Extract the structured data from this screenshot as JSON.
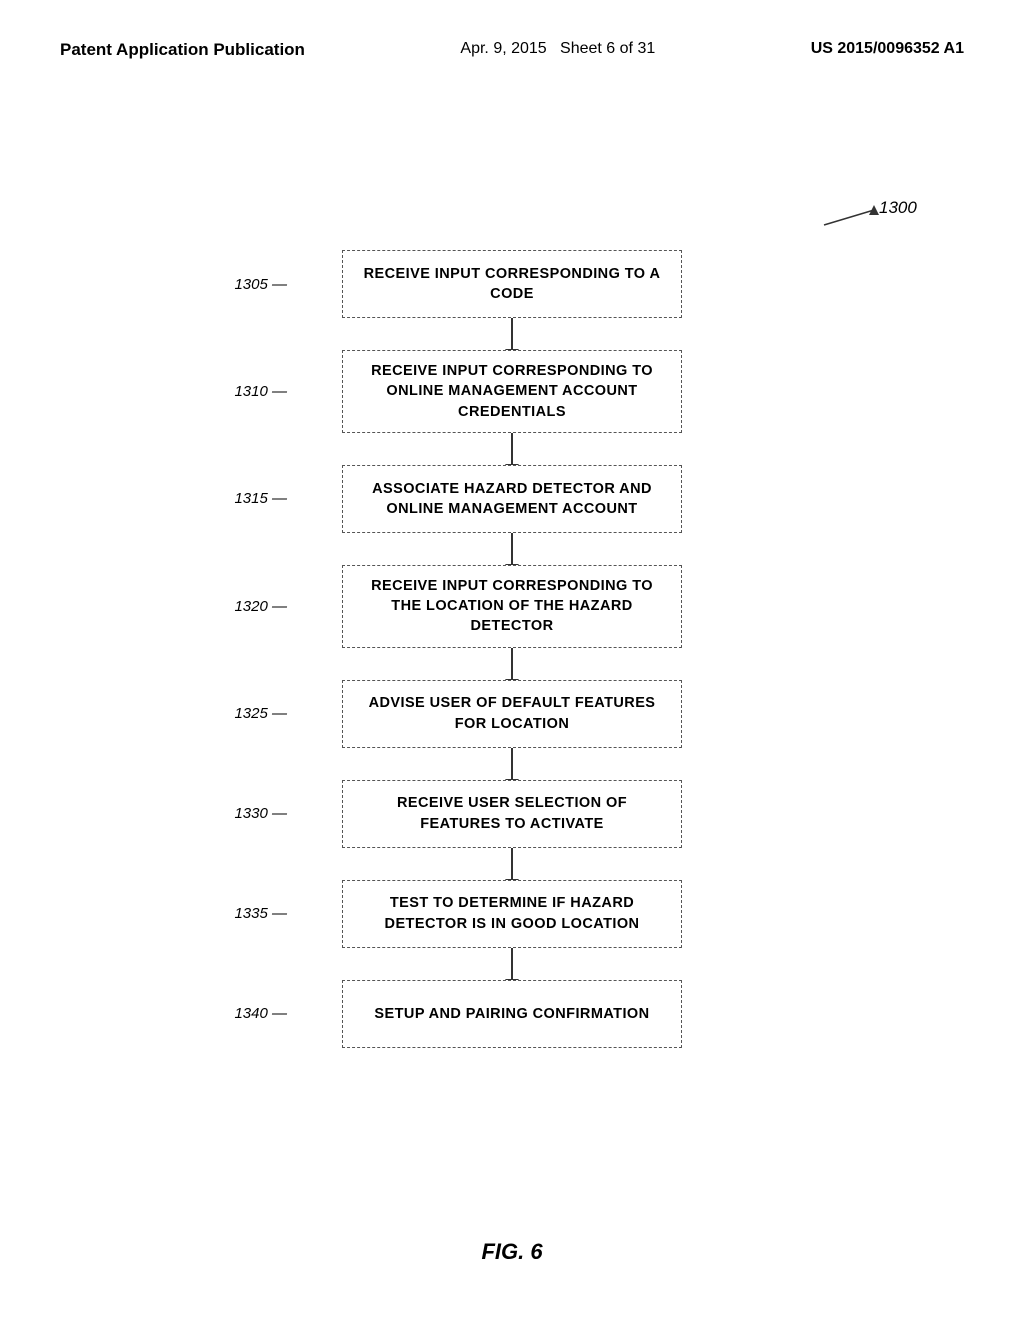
{
  "header": {
    "left": "Patent Application Publication",
    "center": "Apr. 9, 2015",
    "sheet": "Sheet 6 of 31",
    "right": "US 2015/0096352 A1"
  },
  "diagram": {
    "main_label": "1300",
    "steps": [
      {
        "id": "1305",
        "label": "1305",
        "text": "RECEIVE INPUT CORRESPONDING TO A CODE"
      },
      {
        "id": "1310",
        "label": "1310",
        "text": "RECEIVE INPUT CORRESPONDING TO ONLINE MANAGEMENT ACCOUNT CREDENTIALS"
      },
      {
        "id": "1315",
        "label": "1315",
        "text": "ASSOCIATE HAZARD DETECTOR AND ONLINE MANAGEMENT ACCOUNT"
      },
      {
        "id": "1320",
        "label": "1320",
        "text": "RECEIVE INPUT CORRESPONDING TO THE LOCATION OF THE HAZARD DETECTOR"
      },
      {
        "id": "1325",
        "label": "1325",
        "text": "ADVISE USER OF DEFAULT FEATURES FOR LOCATION"
      },
      {
        "id": "1330",
        "label": "1330",
        "text": "RECEIVE USER SELECTION OF FEATURES TO ACTIVATE"
      },
      {
        "id": "1335",
        "label": "1335",
        "text": "TEST TO DETERMINE IF HAZARD DETECTOR IS IN GOOD LOCATION"
      },
      {
        "id": "1340",
        "label": "1340",
        "text": "SETUP AND PAIRING CONFIRMATION"
      }
    ]
  },
  "figure": {
    "caption": "FIG. 6"
  }
}
